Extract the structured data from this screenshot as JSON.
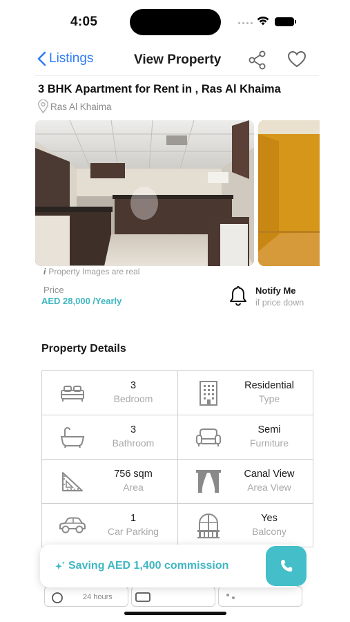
{
  "status_bar": {
    "time": "4:05"
  },
  "nav": {
    "back_label": "Listings",
    "title": "View Property"
  },
  "property": {
    "title": "3 BHK Apartment for Rent in , Ras Al Khaima",
    "location": "Ras Al Khaima",
    "images_note_icon": "i",
    "images_note": "Property Images are real",
    "price_label": "Price",
    "price_value": "AED 28,000 /Yearly"
  },
  "notify": {
    "title": "Notify Me",
    "subtitle": "if price down"
  },
  "details": {
    "section_title": "Property Details",
    "items": [
      {
        "icon": "bed-icon",
        "value": "3",
        "label": "Bedroom"
      },
      {
        "icon": "building-icon",
        "value": "Residential",
        "label": "Type"
      },
      {
        "icon": "bathtub-icon",
        "value": "3",
        "label": "Bathroom"
      },
      {
        "icon": "sofa-icon",
        "value": "Semi",
        "label": "Furniture"
      },
      {
        "icon": "area-ruler-icon",
        "value": "756 sqm",
        "label": "Area"
      },
      {
        "icon": "window-curtains-icon",
        "value": "Canal View",
        "label": "Area View"
      },
      {
        "icon": "car-icon",
        "value": "1",
        "label": "Car Parking"
      },
      {
        "icon": "balcony-door-icon",
        "value": "Yes",
        "label": "Balcony"
      }
    ]
  },
  "bottom_cards": {
    "card1_text": "24 hours"
  },
  "saving_banner": {
    "text": "Saving AED 1,400 commission"
  },
  "colors": {
    "accent": "#3fb7c2",
    "link": "#2f7cf6",
    "call_button": "#44bec8"
  }
}
